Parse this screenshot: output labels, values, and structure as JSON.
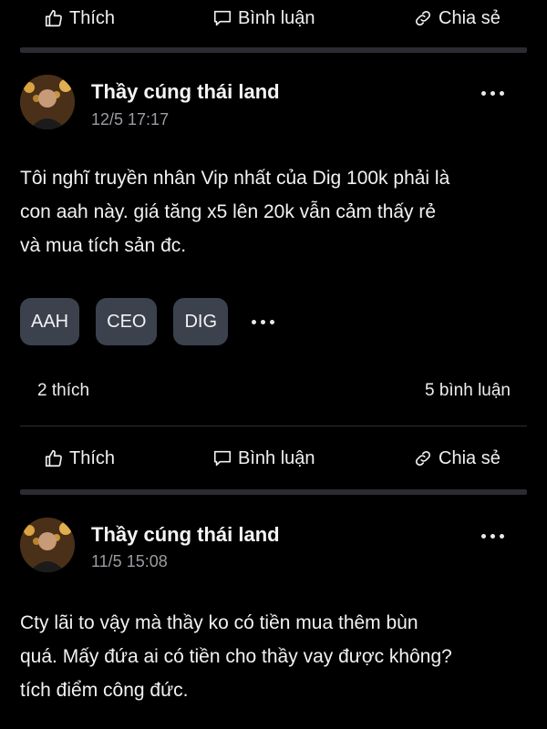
{
  "action_labels": {
    "like": "Thích",
    "comment": "Bình luận",
    "share": "Chia sẻ"
  },
  "posts": [
    {
      "author": "Thầy cúng thái land",
      "time": "12/5 17:17",
      "content_lines": [
        "Tôi nghĩ truyền nhân Vip nhất của Dig 100k phải là",
        "con aah này. giá tăng x5 lên 20k vẫn cảm thấy rẻ",
        "và mua tích sản đc."
      ],
      "tags": [
        "AAH",
        "CEO",
        "DIG"
      ],
      "likes": "2 thích",
      "comments": "5 bình luận"
    },
    {
      "author": "Thầy cúng thái land",
      "time": "11/5 15:08",
      "content_lines": [
        "Cty lãi to vậy mà thầy ko có tiền mua thêm bùn",
        "quá. Mấy đứa ai có tiền cho thầy vay được không?",
        "tích điểm công đức."
      ]
    }
  ],
  "colors": {
    "background": "#000000",
    "tag_bg": "#3b424e",
    "muted_text": "#9a9ca3",
    "separator": "#2a2c31"
  },
  "icons": [
    "thumbs-up-icon",
    "comment-icon",
    "link-icon",
    "more-dots-icon"
  ]
}
